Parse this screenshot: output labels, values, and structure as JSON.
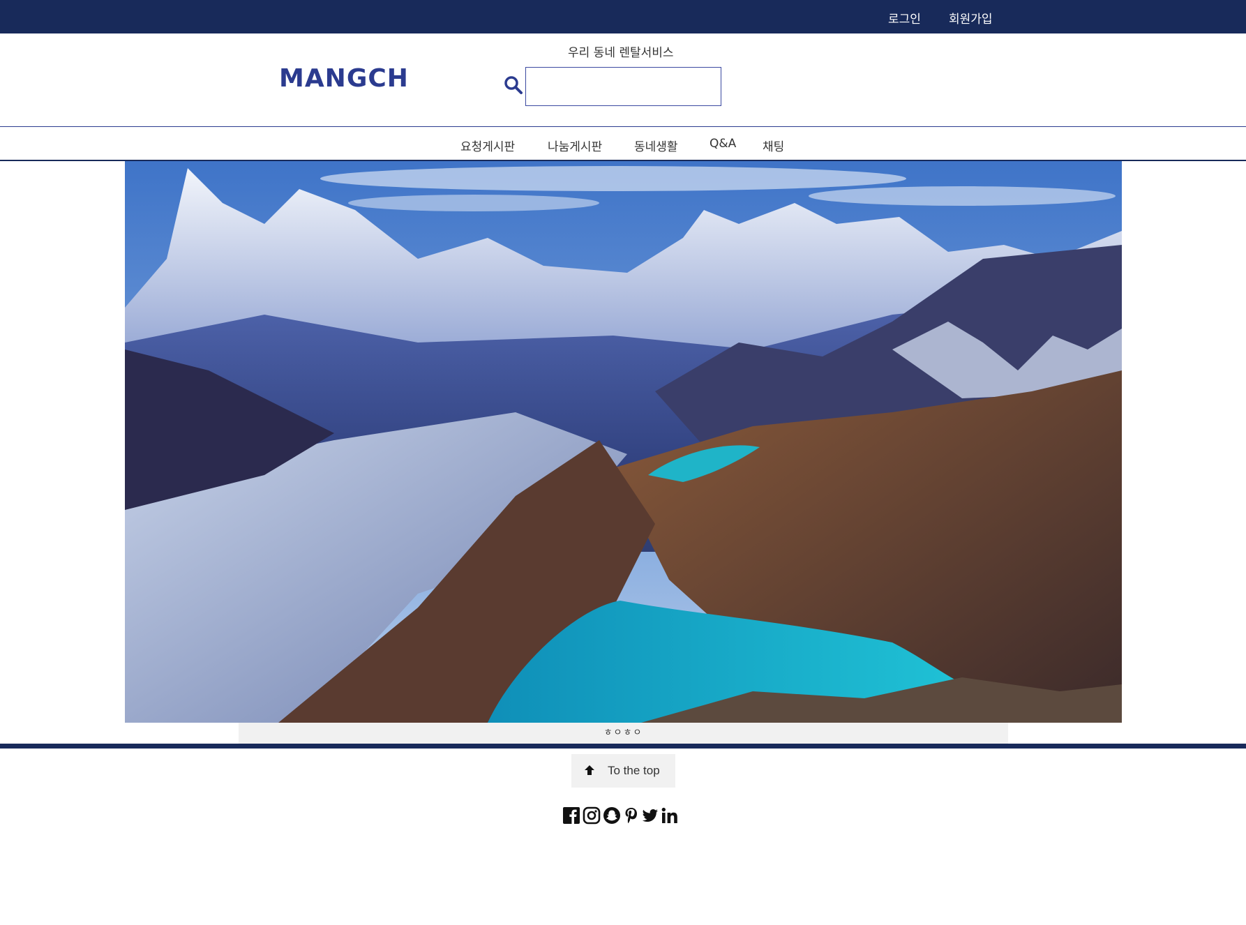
{
  "topbar": {
    "login": "로그인",
    "signup": "회원가입"
  },
  "header": {
    "logo": "MANGCH",
    "tagline": "우리 동네 렌탈서비스",
    "search_value": ""
  },
  "nav": {
    "items": [
      "요청게시판",
      "나눔게시판",
      "동네생활",
      "Q&A",
      "채팅"
    ]
  },
  "hero": {
    "caption": "ㅎㅇㅎㅇ"
  },
  "footer": {
    "to_top_label": "To the top",
    "social_icons": [
      "facebook-icon",
      "instagram-icon",
      "snapchat-icon",
      "pinterest-icon",
      "twitter-icon",
      "linkedin-icon"
    ]
  },
  "colors": {
    "navy": "#182a5a",
    "brand": "#2b3b8f",
    "caption_bg": "#f1f1f1"
  }
}
